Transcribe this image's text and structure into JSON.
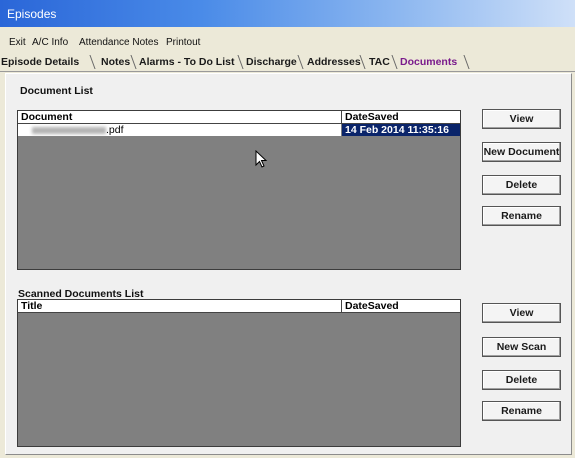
{
  "window": {
    "title": "Episodes"
  },
  "menu": [
    "Exit",
    "A/C Info",
    "Attendance Notes",
    "Printout"
  ],
  "tabs": [
    "Episode Details",
    "Notes",
    "Alarms - To Do List",
    "Discharge",
    "Addresses",
    "TAC",
    "Documents"
  ],
  "active_tab": "Documents",
  "document_list": {
    "label": "Document List",
    "columns": [
      "Document",
      "DateSaved"
    ],
    "rows": [
      {
        "document": ".pdf",
        "date_saved": "14 Feb 2014 11:35:16"
      }
    ],
    "buttons": [
      "View",
      "New Document",
      "Delete",
      "Rename"
    ]
  },
  "scanned_list": {
    "label": "Scanned Documents List",
    "columns": [
      "Title",
      "DateSaved"
    ],
    "buttons": [
      "View",
      "New Scan",
      "Delete",
      "Rename"
    ]
  },
  "colors": {
    "selection": "#0a246a",
    "grid_bg": "#808080",
    "active_tab": "#7a1b8c"
  }
}
